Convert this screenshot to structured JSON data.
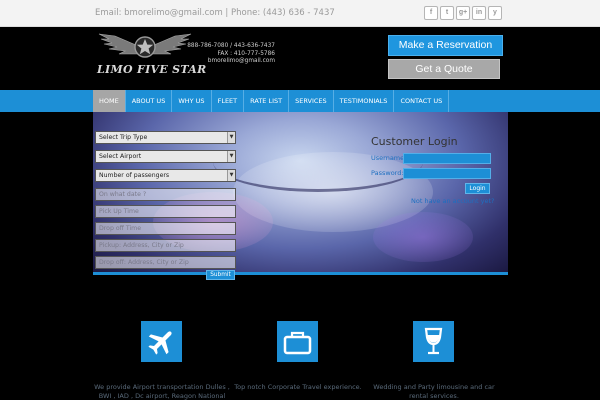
{
  "topbar": {
    "contact": "Email: bmorelimo@gmail.com | Phone: (443) 636 - 7437",
    "social": [
      {
        "icon": "facebook-icon",
        "glyph": "f"
      },
      {
        "icon": "twitter-icon",
        "glyph": "t"
      },
      {
        "icon": "google-plus-icon",
        "glyph": "g+"
      },
      {
        "icon": "linkedin-icon",
        "glyph": "in"
      },
      {
        "icon": "yelp-icon",
        "glyph": "y"
      }
    ]
  },
  "header": {
    "logo_text": "LIMO FIVE STAR",
    "phone_line": "888-786-7080 / 443-636-7437",
    "fax_line": "FAX : 410-777-5786",
    "email_line": "bmorelimo@gmail.com",
    "reservation_label": "Make a Reservation",
    "quote_label": "Get a Quote"
  },
  "nav": {
    "items": [
      "HOME",
      "ABOUT US",
      "WHY US",
      "FLEET",
      "RATE LIST",
      "SERVICES",
      "TESTIMONIALS",
      "CONTACT US"
    ],
    "active": "HOME"
  },
  "booking_form": {
    "trip_type": "Select Trip Type",
    "airport": "Select Airport",
    "passengers": "Number of passengers",
    "date_placeholder": "On what date ?",
    "pickup_time_placeholder": "Pick Up Time",
    "dropoff_time_placeholder": "Drop off Time",
    "pickup_address_placeholder": "Pickup: Address, City or Zip",
    "dropoff_address_placeholder": "Drop off: Address, City or Zip",
    "submit_label": "Submit"
  },
  "login": {
    "title": "Customer Login",
    "username_label": "Username",
    "password_label": "Password:",
    "login_label": "Login",
    "no_account": "Not have an account yet?"
  },
  "features": [
    {
      "icon": "airplane-icon",
      "text": "We provide Airport transportation Dulles , BWI , IAD , Dc airport, Reagon National"
    },
    {
      "icon": "briefcase-icon",
      "text": "Top notch Corporate Travel experience."
    },
    {
      "icon": "wine-glass-icon",
      "text": "Wedding and Party limousine and car rental services."
    }
  ],
  "colors": {
    "accent": "#1d8fd6",
    "active_nav": "#a6a6a6",
    "background": "#000000"
  }
}
